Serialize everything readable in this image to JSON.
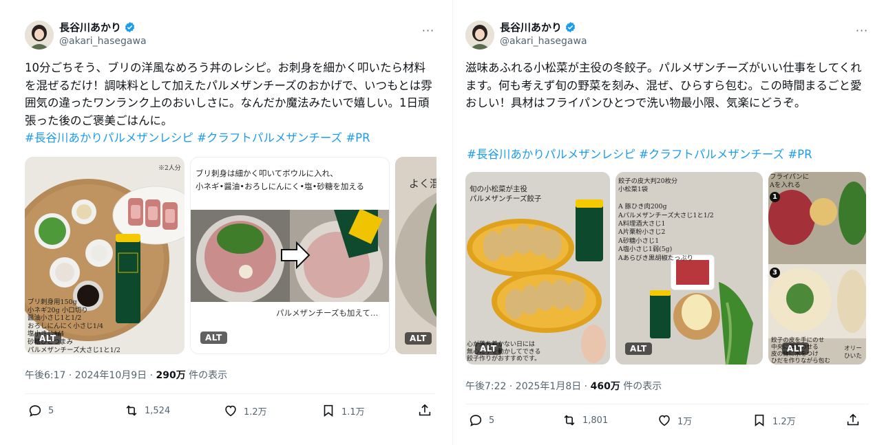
{
  "tweets": [
    {
      "author": {
        "name": "長谷川あかり",
        "handle": "@akari_hasegawa"
      },
      "more_label": "···",
      "text": "10分ごちそう、ブリの洋風なめろう丼のレシピ。お刺身を細かく叩いたら材料を混ぜるだけ！調味料として加えたパルメザンチーズのおかげで、いつもとは雰囲気の違ったワンランク上のおいしさに。なんだか魔法みたいで嬉しい。1日頑張った後のご褒美ごはんに。",
      "hashtags": "#長谷川あかりパルメザンレシピ #クラフトパルメザンチーズ #PR",
      "photos": [
        {
          "alt_label": "ALT",
          "note_top": "※2人分",
          "ingredients": [
            "ブリ刺身用150g",
            "小ネギ20g 小口切り",
            "醤油小さじ1と1/2",
            "おろしにんにく小さじ1/4",
            "塩小さじ1/4",
            "砂糖ひとつまみ",
            "パルメザンチーズ大さじ1と1/2"
          ]
        },
        {
          "alt_label": "ALT",
          "caption_lines": [
            "ブリ刺身は細かく叩いてボウルに入れ、",
            "小ネギ•醤油•おろしにんにく•塩•砂糖を加える"
          ],
          "caption_bottom": "パルメザンチーズも加えて…"
        },
        {
          "alt_label": "ALT",
          "caption_top": "よく混"
        }
      ],
      "timestamp": "午後6:17 · 2024年10月9日 · ",
      "views_count": "290万",
      "views_label": " 件の表示",
      "actions": {
        "replies": "5",
        "reposts": "1,524",
        "likes": "1.2万",
        "bookmarks": "1.1万"
      }
    },
    {
      "author": {
        "name": "長谷川あかり",
        "handle": "@akari_hasegawa"
      },
      "more_label": "···",
      "text": "滋味あふれる小松菜が主役の冬餃子。パルメザンチーズがいい仕事をしてくれます。何も考えず旬の野菜を刻み、混ぜ、ひらすら包む。この時間まるごと愛おしい！具材はフライパンひとつで洗い物最小限、気楽にどうぞ。",
      "hashtags": "#長谷川あかりパルメザンレシピ #クラフトパルメザンチーズ #PR",
      "photos": [
        {
          "alt_label": "ALT",
          "title_lines": [
            "旬の小松菜が主役",
            "パルメザンチーズ餃子"
          ],
          "bottom_lines": [
            "心が落ち着かない日には",
            "無心に手を動かしてできる",
            "餃子作りがおすすめです。"
          ]
        },
        {
          "alt_label": "ALT",
          "ingredients": [
            "餃子の皮大判20枚分",
            "小松菜1袋",
            "",
            "A 豚ひき肉200g",
            "Aパルメザンチーズ大さじ1と1/2",
            "A料理酒大さじ1",
            "A片栗粉小さじ2",
            "A砂糖小さじ1",
            "A塩小さじ1弱(5g)",
            "Aあらびき黒胡椒たっぷり"
          ]
        },
        {
          "alt_label": "ALT",
          "top_lines": [
            "フライパンに",
            "Aを入れる"
          ],
          "step_numbers": [
            "1",
            "3"
          ],
          "bottom_lines": [
            "餃子の皮を手にのせ",
            "中央に具をのせる",
            "皮の縁に水をつけ",
            "ひだを作りながら包む"
          ],
          "side_lines": [
            "オリー",
            "ひいた"
          ]
        }
      ],
      "timestamp": "午後7:22 · 2025年1月8日 · ",
      "views_count": "460万",
      "views_label": " 件の表示",
      "actions": {
        "replies": "5",
        "reposts": "1,801",
        "likes": "1万",
        "bookmarks": "1.2万"
      }
    }
  ],
  "colors": {
    "link": "#1d9bf0",
    "secondary": "#536471",
    "verified": "#1d9bf0",
    "divider": "#eff3f4"
  }
}
